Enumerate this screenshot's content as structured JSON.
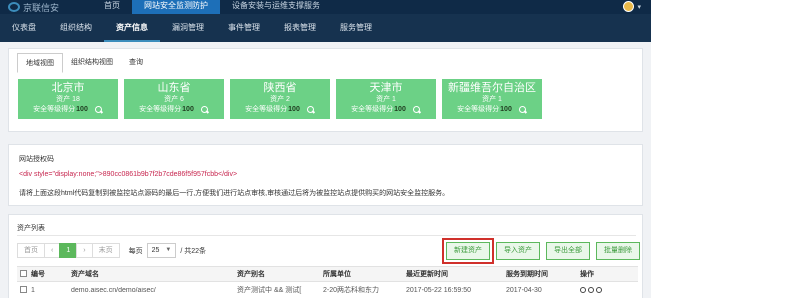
{
  "topbar": {
    "logo_text": "京联信安",
    "nav": [
      {
        "label": "首页",
        "active": false
      },
      {
        "label": "网站安全监测防护",
        "active": true
      },
      {
        "label": "设备安装与运维支撑服务",
        "active": false
      }
    ]
  },
  "subnav": {
    "items": [
      {
        "label": "仪表盘",
        "active": false
      },
      {
        "label": "组织结构",
        "active": false
      },
      {
        "label": "资产信息",
        "active": true
      },
      {
        "label": "漏洞管理",
        "active": false
      },
      {
        "label": "事件管理",
        "active": false
      },
      {
        "label": "报表管理",
        "active": false
      },
      {
        "label": "服务管理",
        "active": false
      }
    ]
  },
  "view_tabs": [
    {
      "label": "地域视图",
      "active": true
    },
    {
      "label": "组织结构视图",
      "active": false
    },
    {
      "label": "查询",
      "active": false
    }
  ],
  "regions": [
    {
      "name": "北京市",
      "count_text": "资产 18",
      "score_label": "安全等级得分",
      "score": "100"
    },
    {
      "name": "山东省",
      "count_text": "资产 6",
      "score_label": "安全等级得分",
      "score": "100"
    },
    {
      "name": "陕西省",
      "count_text": "资产 2",
      "score_label": "安全等级得分",
      "score": "100"
    },
    {
      "name": "天津市",
      "count_text": "资产 1",
      "score_label": "安全等级得分",
      "score": "100"
    },
    {
      "name": "新疆维吾尔自治区",
      "count_text": "资产 1",
      "score_label": "安全等级得分",
      "score": "100"
    }
  ],
  "auth": {
    "title": "网站授权码",
    "code": "<div style=\"display:none;\">890cc0861b9b7f2b7cde86f5f957fcbb</div>",
    "desc": "请将上面这段html代码复制到被监控站点源码的最后一行,方便我们进行站点审核,审核通过后将为被监控站点提供购买的网站安全监控服务。"
  },
  "assets": {
    "title": "资产列表",
    "pager": {
      "first": "首页",
      "prev": "‹",
      "current": "1",
      "next": "›",
      "last": "末页"
    },
    "per_page_label": "每页",
    "per_page_value": "25",
    "total_text": "/ 共22条",
    "buttons": {
      "new": "新建资产",
      "import": "导入资产",
      "export": "导出全部",
      "bulk_delete": "批量删除"
    },
    "columns": [
      "编号",
      "资产域名",
      "资产别名",
      "所属单位",
      "最近更新时间",
      "服务到期时间",
      "操作"
    ],
    "rows": [
      {
        "id": "1",
        "domain": "demo.aisec.cn/demo/aisec/",
        "alias": "资产测试中 && 测试[",
        "unit": "2-20两芯科和东力",
        "updated": "2017-05-22 16:59:50",
        "expires": "2017-04-30"
      }
    ]
  }
}
